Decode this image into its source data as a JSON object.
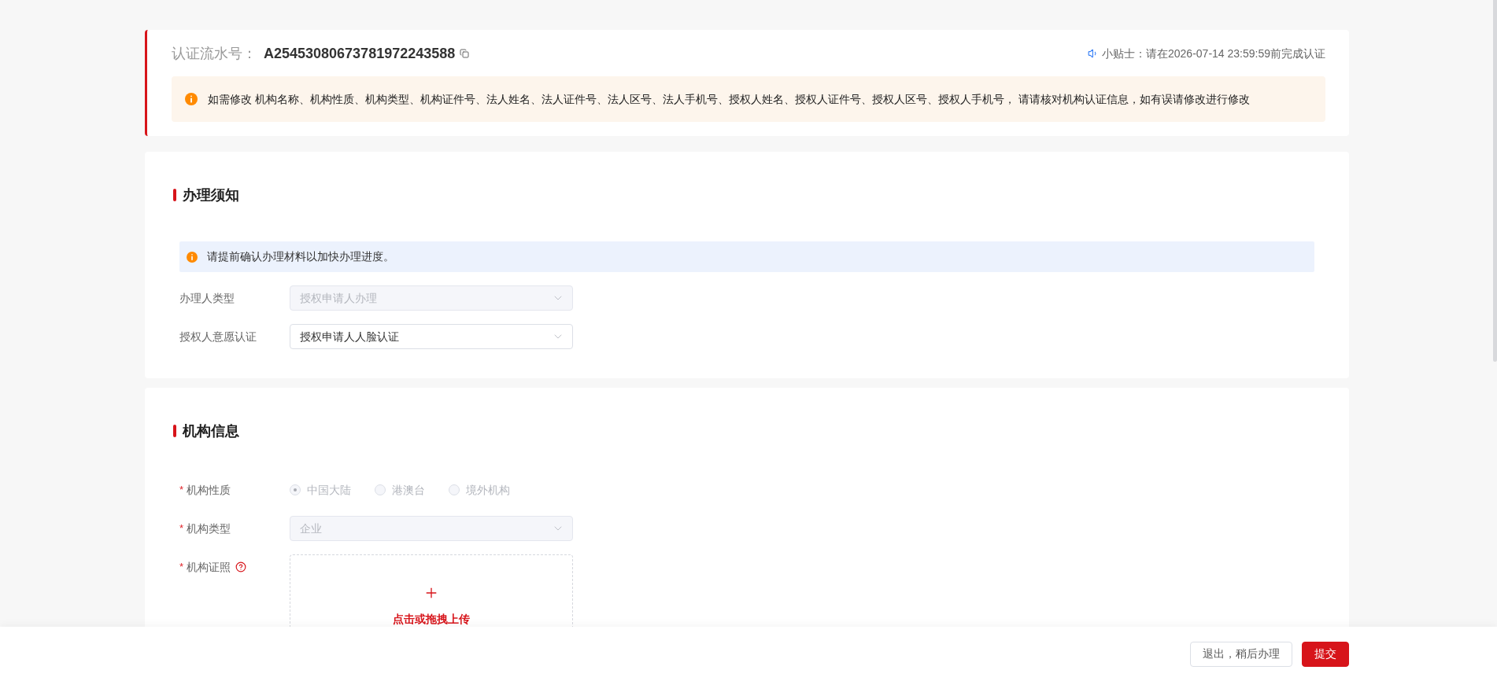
{
  "header": {
    "serial_label": "认证流水号：",
    "serial_number": "A25453080673781972243588",
    "tip": "小贴士：请在2026-07-14 23:59:59前完成认证",
    "notice": "如需修改 机构名称、机构性质、机构类型、机构证件号、法人姓名、法人证件号、法人区号、法人手机号、授权人姓名、授权人证件号、授权人区号、授权人手机号， 请请核对机构认证信息，如有误请修改进行修改"
  },
  "sections": [
    {
      "title": "办理须知",
      "notice": "请提前确认办理材料以加快办理进度。",
      "fields": [
        {
          "kind": "select",
          "label": "办理人类型",
          "value": "授权申请人办理",
          "disabled": true
        },
        {
          "kind": "select",
          "label": "授权人意愿认证",
          "value": "授权申请人人脸认证",
          "disabled": false
        }
      ]
    },
    {
      "title": "机构信息",
      "fields": [
        {
          "kind": "radio",
          "label": "机构性质",
          "required_mark": "*",
          "disabled": true,
          "options": [
            {
              "label": "中国大陆",
              "selected": true
            },
            {
              "label": "港澳台",
              "selected": false
            },
            {
              "label": "境外机构",
              "selected": false
            }
          ]
        },
        {
          "kind": "select",
          "label": "机构类型",
          "required_mark": "*",
          "value": "企业",
          "disabled": true
        },
        {
          "kind": "upload",
          "label": "机构证照",
          "required_mark": "*",
          "help": true,
          "text": "点击或拖拽上传"
        }
      ]
    }
  ],
  "footer": {
    "buttons": [
      {
        "label": "退出，稍后办理",
        "kind": "secondary"
      },
      {
        "label": "提交",
        "kind": "primary"
      }
    ]
  }
}
